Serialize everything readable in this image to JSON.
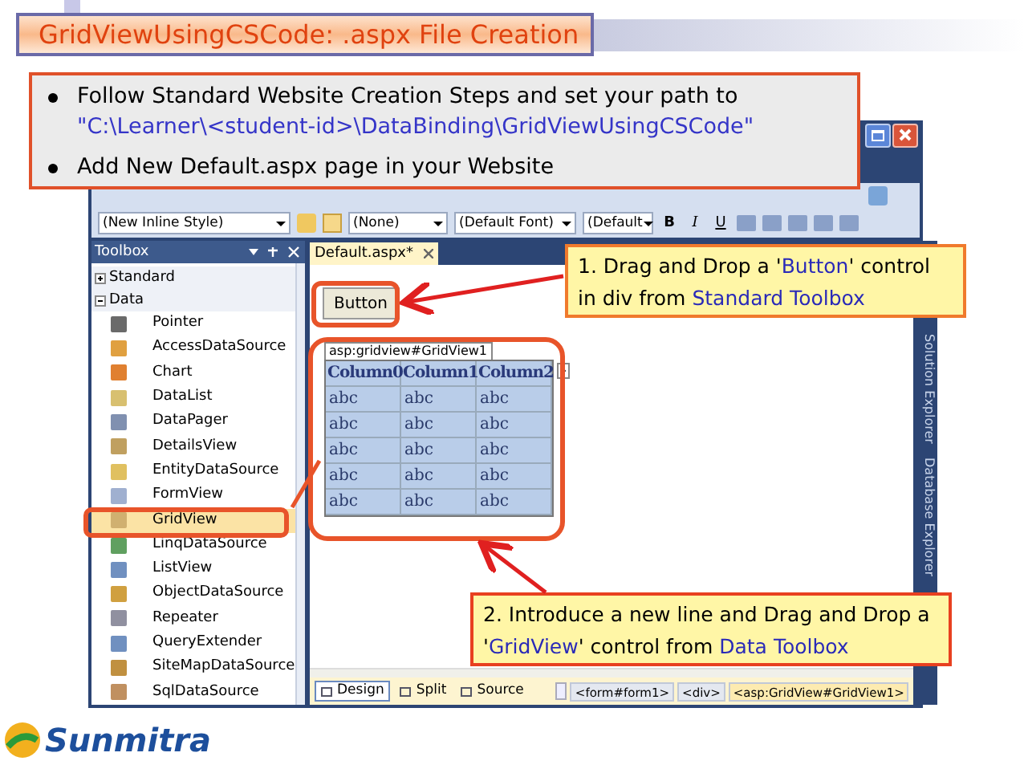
{
  "slide_title": "GridViewUsingCSCode: .aspx File Creation",
  "instructions": [
    {
      "text": "Follow Standard Website Creation Steps and set your path to",
      "path": "\"C:\\Learner\\<student-id>\\DataBinding\\GridViewUsingCSCode\""
    },
    {
      "text": "Add New Default.aspx page in your Website"
    }
  ],
  "ide": {
    "toolbar": {
      "dropdowns": [
        "(New Inline Style)",
        "(None)",
        "(Default Font)",
        "(Default"
      ],
      "format_buttons": [
        "B",
        "I",
        "U"
      ]
    },
    "toolbox": {
      "title": "Toolbox",
      "groups": [
        {
          "label": "Standard",
          "expanded": false
        },
        {
          "label": "Data",
          "expanded": true,
          "items": [
            {
              "label": "Pointer",
              "selected": false
            },
            {
              "label": "AccessDataSource",
              "selected": false
            },
            {
              "label": "Chart",
              "selected": false
            },
            {
              "label": "DataList",
              "selected": false
            },
            {
              "label": "DataPager",
              "selected": false
            },
            {
              "label": "DetailsView",
              "selected": false
            },
            {
              "label": "EntityDataSource",
              "selected": false
            },
            {
              "label": "FormView",
              "selected": false
            },
            {
              "label": "GridView",
              "selected": true
            },
            {
              "label": "LinqDataSource",
              "selected": false
            },
            {
              "label": "ListView",
              "selected": false
            },
            {
              "label": "ObjectDataSource",
              "selected": false
            },
            {
              "label": "Repeater",
              "selected": false
            },
            {
              "label": "QueryExtender",
              "selected": false
            },
            {
              "label": "SiteMapDataSource",
              "selected": false
            },
            {
              "label": "SqlDataSource",
              "selected": false
            }
          ]
        }
      ]
    },
    "document_tab": "Default.aspx*",
    "designer": {
      "button_label": "Button",
      "grid_tag": "asp:gridview#GridView1",
      "columns": [
        "Column0",
        "Column1",
        "Column2"
      ],
      "rows": [
        [
          "abc",
          "abc",
          "abc"
        ],
        [
          "abc",
          "abc",
          "abc"
        ],
        [
          "abc",
          "abc",
          "abc"
        ],
        [
          "abc",
          "abc",
          "abc"
        ],
        [
          "abc",
          "abc",
          "abc"
        ]
      ]
    },
    "view_tabs": [
      {
        "label": "Design",
        "selected": true
      },
      {
        "label": "Split",
        "selected": false
      },
      {
        "label": "Source",
        "selected": false
      }
    ],
    "breadcrumb": [
      "<form#form1>",
      "<div>",
      "<asp:GridView#GridView1>"
    ],
    "side_tabs": [
      "Solution Explorer",
      "Database Explorer"
    ]
  },
  "callouts": [
    {
      "parts": [
        {
          "text": "1. Drag and Drop a '",
          "highlight": false
        },
        {
          "text": "Button",
          "highlight": true
        },
        {
          "text": "' control in div from ",
          "highlight": false
        },
        {
          "text": "Standard Toolbox",
          "highlight": true
        }
      ]
    },
    {
      "parts": [
        {
          "text": "2. Introduce a new line and Drag and Drop a '",
          "highlight": false
        },
        {
          "text": "GridView",
          "highlight": true
        },
        {
          "text": "' control from ",
          "highlight": false
        },
        {
          "text": "Data Toolbox",
          "highlight": true
        }
      ]
    }
  ],
  "logo": "Sunmitra"
}
